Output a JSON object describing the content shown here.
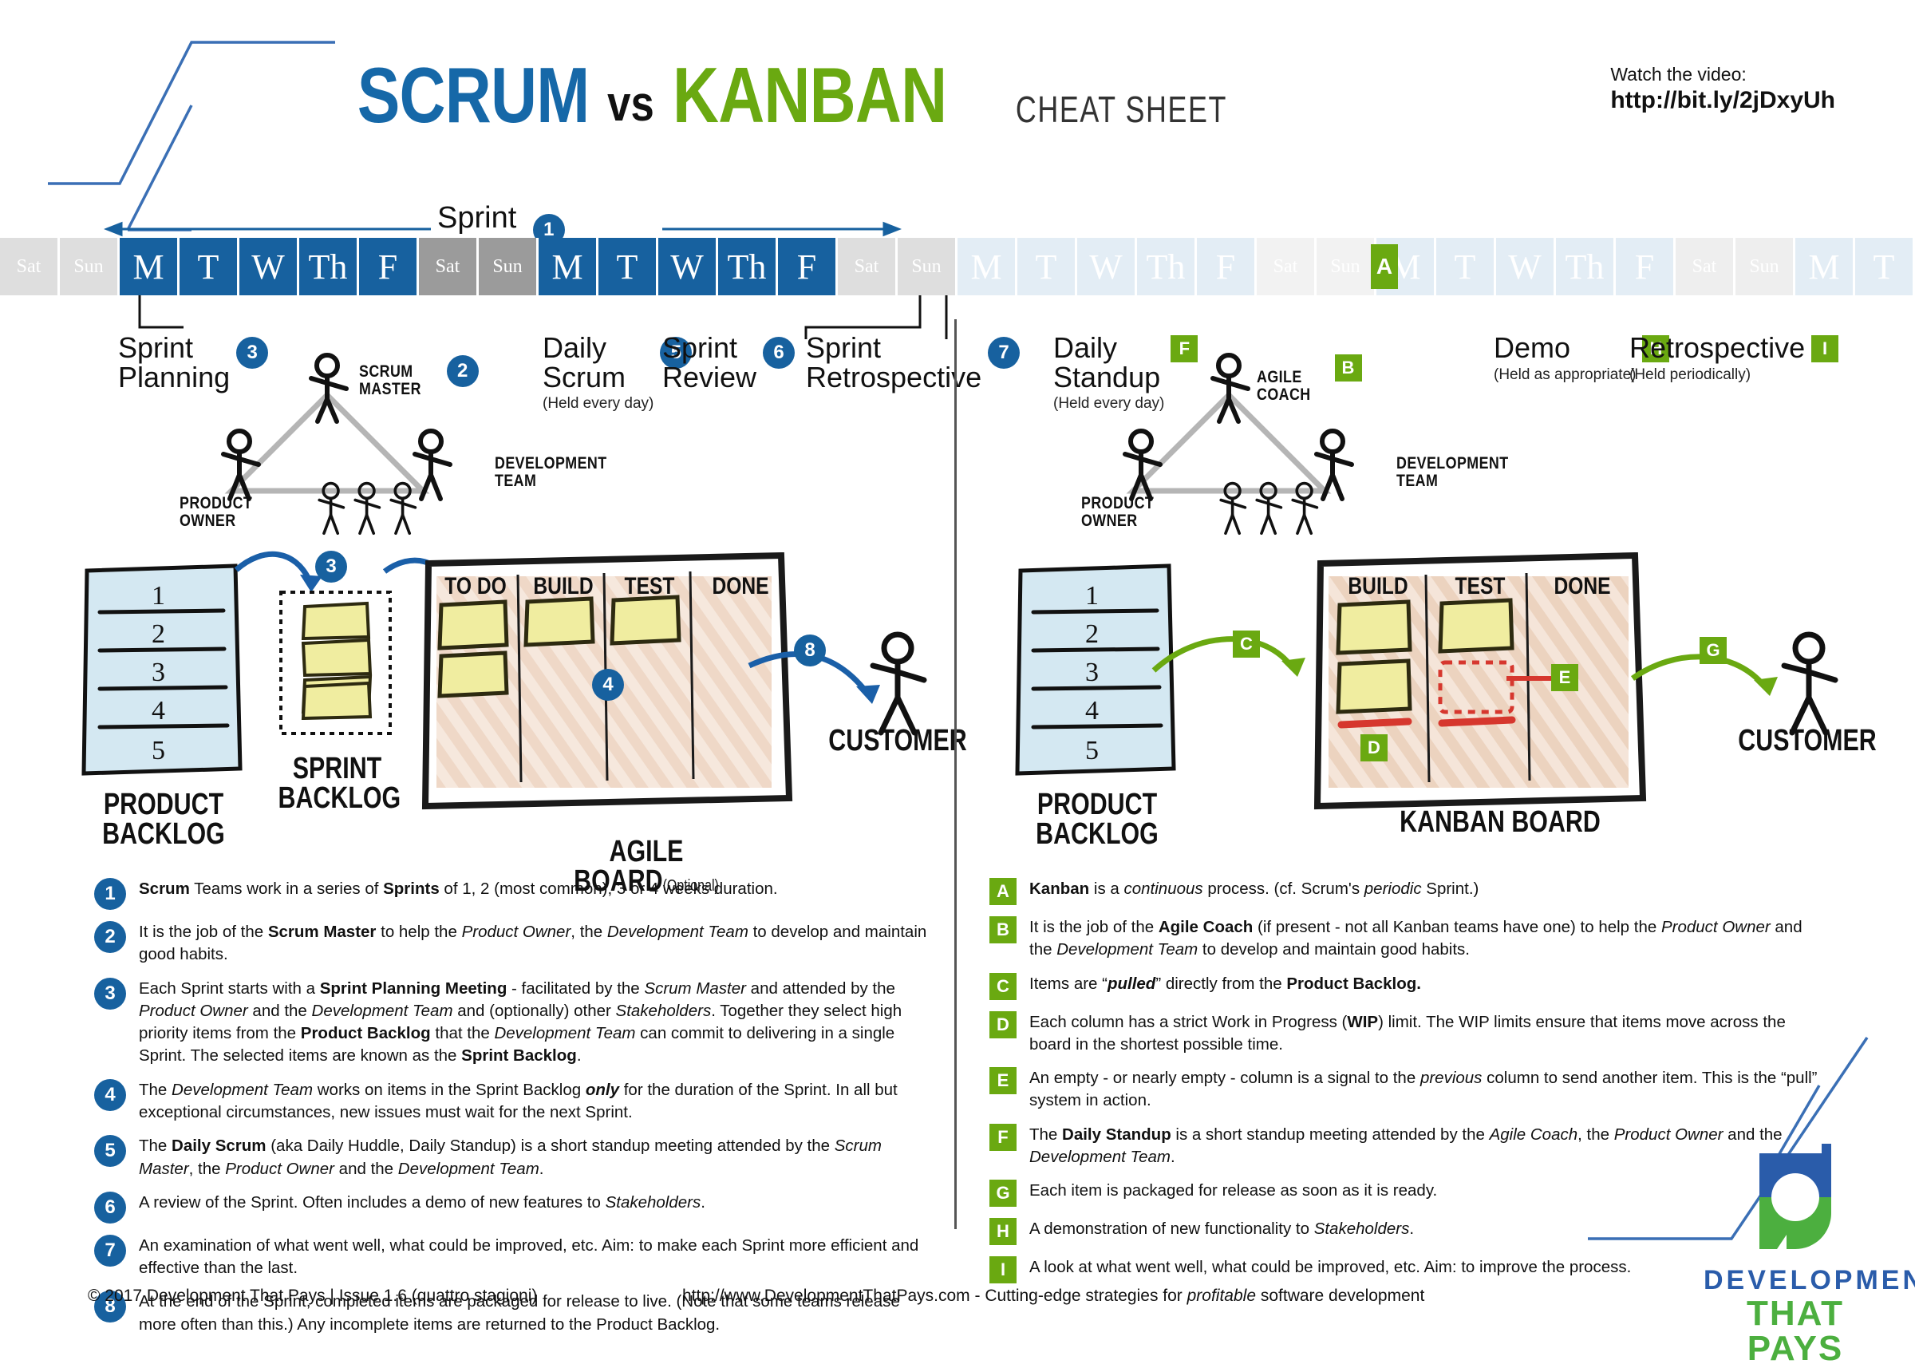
{
  "header": {
    "title_scrum": "SCRUM",
    "title_vs": "vs",
    "title_kanban": "KANBAN",
    "title_cheat": "CHEAT SHEET",
    "video_label": "Watch the video:",
    "video_url": "http://bit.ly/2jDxyUh",
    "color_scrum": "#1668a8",
    "color_kanban": "#6aa911"
  },
  "calendar": {
    "sprint_label": "Sprint",
    "sprint_badge": "1",
    "kanban_badge": "A",
    "cells": [
      {
        "d": "Sat",
        "t": "off"
      },
      {
        "d": "Sun",
        "t": "off"
      },
      {
        "d": "M",
        "t": "week"
      },
      {
        "d": "T",
        "t": "week"
      },
      {
        "d": "W",
        "t": "week"
      },
      {
        "d": "Th",
        "t": "week"
      },
      {
        "d": "F",
        "t": "week"
      },
      {
        "d": "Sat",
        "t": "weekend"
      },
      {
        "d": "Sun",
        "t": "weekend"
      },
      {
        "d": "M",
        "t": "week"
      },
      {
        "d": "T",
        "t": "week"
      },
      {
        "d": "W",
        "t": "week"
      },
      {
        "d": "Th",
        "t": "week"
      },
      {
        "d": "F",
        "t": "week"
      },
      {
        "d": "Sat",
        "t": "off"
      },
      {
        "d": "Sun",
        "t": "off"
      },
      {
        "d": "M",
        "t": "week"
      },
      {
        "d": "T",
        "t": "week"
      },
      {
        "d": "W",
        "t": "week"
      },
      {
        "d": "Th",
        "t": "week"
      },
      {
        "d": "F",
        "t": "week"
      },
      {
        "d": "Sat",
        "t": "weekend"
      },
      {
        "d": "Sun",
        "t": "weekend"
      },
      {
        "d": "M",
        "t": "week"
      },
      {
        "d": "T",
        "t": "week"
      },
      {
        "d": "W",
        "t": "week"
      },
      {
        "d": "Th",
        "t": "week"
      },
      {
        "d": "F",
        "t": "week"
      },
      {
        "d": "Sat",
        "t": "off"
      },
      {
        "d": "Sun",
        "t": "off"
      },
      {
        "d": "M",
        "t": "week"
      },
      {
        "d": "T",
        "t": "week"
      }
    ]
  },
  "scrum": {
    "events": {
      "sprint_planning": {
        "label": "Sprint\nPlanning",
        "badge": "3"
      },
      "scrum_master": {
        "label": "SCRUM\nMASTER",
        "badge": "2"
      },
      "daily_scrum": {
        "label": "Daily\nScrum",
        "sub": "(Held every day)",
        "badge": "5"
      },
      "sprint_review": {
        "label": "Sprint\nReview",
        "badge": "6"
      },
      "sprint_retro": {
        "label": "Sprint\nRetrospective",
        "badge": "7"
      }
    },
    "roles": {
      "product_owner": "PRODUCT\nOWNER",
      "development_team": "DEVELOPMENT\nTEAM"
    },
    "board": {
      "product_backlog_caption": "PRODUCT\nBACKLOG",
      "product_backlog_items": [
        "1",
        "2",
        "3",
        "4",
        "5"
      ],
      "sprint_backlog_caption": "SPRINT\nBACKLOG",
      "sprint_backlog_badge": "3",
      "sprint_backlog_notes": 4,
      "agile_board_caption": "AGILE BOARD",
      "agile_board_optional": "(Optional)",
      "agile_board_badge": "4",
      "columns": [
        {
          "name": "TO DO",
          "notes": 2
        },
        {
          "name": "BUILD",
          "notes": 1
        },
        {
          "name": "TEST",
          "notes": 1
        },
        {
          "name": "DONE",
          "notes": 0
        }
      ],
      "customer_caption": "CUSTOMER",
      "customer_badge": "8"
    },
    "legend": [
      {
        "id": "1",
        "html": "<b>Scrum</b> Teams work in a series of <b>Sprints</b> of 1, 2 (most common), 3 or 4 weeks duration."
      },
      {
        "id": "2",
        "html": "It is the job of the <b>Scrum Master</b> to help the <i>Product Owner</i>, the <i>Development Team</i> to develop and maintain good habits."
      },
      {
        "id": "3",
        "html": "Each Sprint starts with a <b>Sprint Planning Meeting</b> - facilitated by the <i>Scrum Master</i> and attended by the <i>Product Owner</i> and the <i>Development Team</i> and (optionally) other <i>Stakeholders</i>. Together they select high priority items from the <b>Product Backlog</b> that the <i>Development Team</i> can commit to delivering in a single Sprint. The selected items are known as the <b>Sprint Backlog</b>."
      },
      {
        "id": "4",
        "html": "The <i>Development Team</i> works on items in the Sprint Backlog <b><i>only</i></b> for the duration of the Sprint. In all but exceptional circumstances, new issues must wait for the next Sprint."
      },
      {
        "id": "5",
        "html": "The <b>Daily Scrum</b> (aka Daily Huddle, Daily Standup) is a short standup meeting attended by the <i>Scrum Master</i>, the <i>Product Owner</i> and the <i>Development Team</i>."
      },
      {
        "id": "6",
        "html": "A review of the Sprint. Often includes a demo of new features to <i>Stakeholders</i>."
      },
      {
        "id": "7",
        "html": "An examination of what went well, what could be improved, etc. Aim: to make each Sprint more efficient and effective than the last."
      },
      {
        "id": "8",
        "html": "At the end of the Sprint, completed items are packaged for release to live. (Note that some teams release more often than this.) Any incomplete items are returned to the Product Backlog."
      }
    ]
  },
  "kanban": {
    "events": {
      "daily_standup": {
        "label": "Daily\nStandup",
        "sub": "(Held every day)",
        "badge": "F"
      },
      "agile_coach": {
        "label": "AGILE\nCOACH",
        "badge": "B"
      },
      "demo": {
        "label": "Demo",
        "sub": "(Held as appropriate)",
        "badge": "H"
      },
      "retrospective": {
        "label": "Retrospective",
        "sub": "(Held periodically)",
        "badge": "I"
      }
    },
    "roles": {
      "product_owner": "PRODUCT\nOWNER",
      "development_team": "DEVELOPMENT\nTEAM"
    },
    "board": {
      "product_backlog_caption": "PRODUCT\nBACKLOG",
      "product_backlog_items": [
        "1",
        "2",
        "3",
        "4",
        "5"
      ],
      "kanban_board_caption": "KANBAN BOARD",
      "pull_badge": "C",
      "wip_badge": "D",
      "empty_col_badge": "E",
      "release_badge": "G",
      "columns": [
        {
          "name": "BUILD",
          "notes": 2
        },
        {
          "name": "TEST",
          "notes": 1
        },
        {
          "name": "DONE",
          "notes": 0
        }
      ],
      "customer_caption": "CUSTOMER"
    },
    "legend": [
      {
        "id": "A",
        "html": "<b>Kanban</b> is a <i>continuous</i> process. (cf. Scrum's <i>periodic</i> Sprint.)"
      },
      {
        "id": "B",
        "html": "It is the job of the <b>Agile Coach</b> (if present - not all Kanban teams have one) to help the <i>Product Owner</i> and the <i>Development Team</i> to develop and maintain good habits."
      },
      {
        "id": "C",
        "html": "Items are &ldquo;<b><i>pulled</i></b>&rdquo; directly from the <b>Product Backlog.</b>"
      },
      {
        "id": "D",
        "html": "Each column has a strict Work in Progress (<b>WIP</b>) limit. The WIP limits ensure that items move across the board in the shortest possible time."
      },
      {
        "id": "E",
        "html": "An empty - or nearly empty - column is a signal to the <i>previous</i> column to send another item. This is the &ldquo;pull&rdquo; system in action."
      },
      {
        "id": "F",
        "html": "The <b>Daily Standup</b> is a short standup meeting attended by the <i>Agile Coach</i>, the <i>Product Owner</i> and the <i>Development Team</i>."
      },
      {
        "id": "G",
        "html": "Each item is packaged for release as soon as it is ready."
      },
      {
        "id": "H",
        "html": "A demonstration of new functionality to <i>Stakeholders</i>."
      },
      {
        "id": "I",
        "html": "A look at what went well, what could be improved, etc. Aim: to improve the process."
      }
    ]
  },
  "footer": {
    "copyright": "© 2017 Development That Pays | Issue 1.6 (quattro stagioni)",
    "tagline_html": "http://www.DevelopmentThatPays.com  -  Cutting-edge strategies for <i>profitable</i> software development"
  },
  "logo": {
    "line1": "DEVELOPMENT",
    "line2": "THAT PAYS",
    "color_blue": "#2a5caa",
    "color_green": "#4caf3f"
  }
}
